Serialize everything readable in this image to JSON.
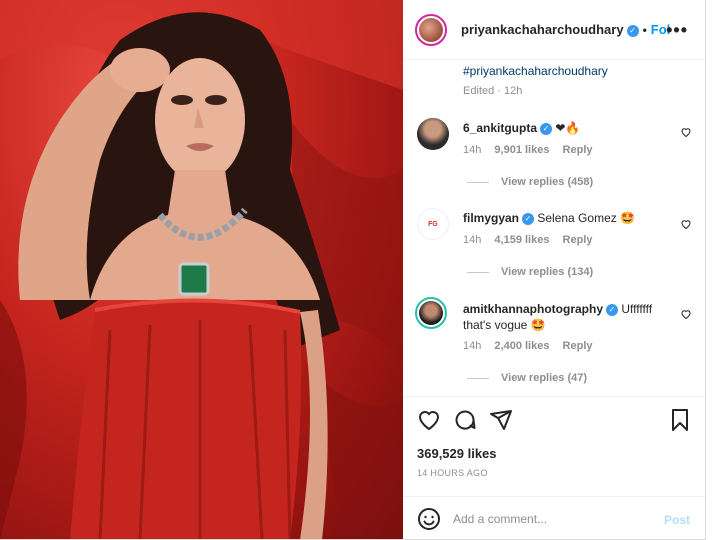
{
  "header": {
    "username": "priyankachaharchoudhary",
    "verified_icon": "verified-badge-icon",
    "separator": "•",
    "follow_label": "Fol",
    "more_label": "•••"
  },
  "caption": {
    "hashtag": "#priyankachaharchoudhary",
    "edited": "Edited · 12h"
  },
  "comments": [
    {
      "username": "6_ankitgupta",
      "text": "❤🔥",
      "time": "14h",
      "likes": "9,901 likes",
      "reply_label": "Reply",
      "view_replies": "View replies (458)"
    },
    {
      "username": "filmygyan",
      "text": "Selena Gomez 🤩",
      "time": "14h",
      "likes": "4,159 likes",
      "reply_label": "Reply",
      "view_replies": "View replies (134)"
    },
    {
      "username": "amitkhannaphotography",
      "text": "Ufffffff that's vogue 🤩",
      "time": "14h",
      "likes": "2,400 likes",
      "reply_label": "Reply",
      "view_replies": "View replies (47)"
    }
  ],
  "post": {
    "likes": "369,529 likes",
    "time_ago": "14 HOURS AGO"
  },
  "add_comment": {
    "placeholder": "Add a comment...",
    "post_label": "Post"
  },
  "colors": {
    "accent": "#0095f6",
    "verified": "#3897f0",
    "photo_red": "#c7261f"
  }
}
